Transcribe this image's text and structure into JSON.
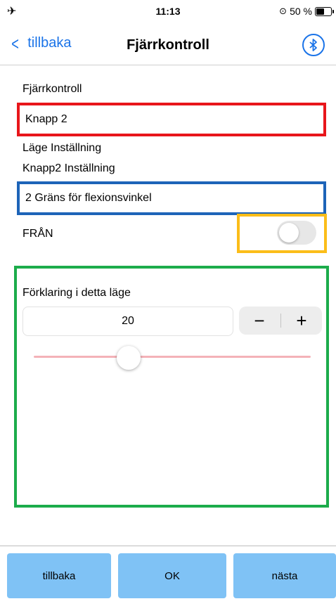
{
  "status_bar": {
    "time": "11:13",
    "battery_text": "50 %"
  },
  "nav": {
    "back_label": "tillbaka",
    "title": "Fjärrkontroll"
  },
  "form": {
    "remote_label": "Fjärrkontroll",
    "remote_value": "Knapp 2",
    "mode_setting_label": "Läge Inställning",
    "button_setting_label": "Knapp2 Inställning",
    "setting_value": "2 Gräns för flexionsvinkel",
    "toggle_label": "FRÅN",
    "toggle_on": false
  },
  "explanation": {
    "label": "Förklaring i detta läge",
    "value": "20",
    "minus": "−",
    "plus": "+"
  },
  "toolbar": {
    "back": "tillbaka",
    "ok": "OK",
    "next": "nästa"
  },
  "colors": {
    "accent": "#1a73e8",
    "highlight_red": "#e8161b",
    "highlight_blue": "#1d64b8",
    "highlight_yellow": "#fbbd19",
    "highlight_green": "#1cac4b",
    "toolbar_button": "#7fc2f5",
    "slider_track": "#f4b2b8"
  },
  "icons": [
    "airplane-icon",
    "screen-lock-icon",
    "battery-icon",
    "chevron-left-icon",
    "bluetooth-icon"
  ]
}
